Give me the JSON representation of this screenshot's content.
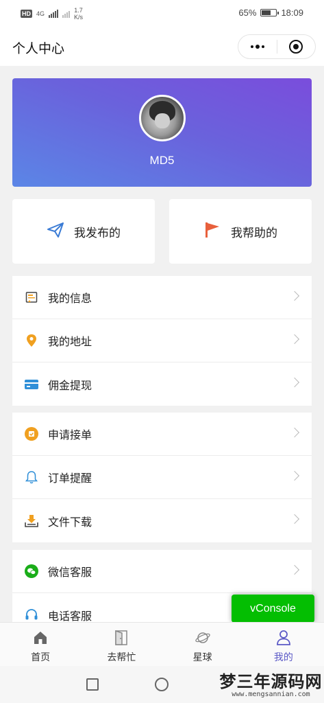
{
  "status_bar": {
    "hd": "HD",
    "network": "4G",
    "speed_value": "1.7",
    "speed_unit": "K/s",
    "battery": "65%",
    "battery_level": 0.65,
    "time": "18:09"
  },
  "navbar": {
    "title": "个人中心",
    "more_icon": "more-dots-icon",
    "close_icon": "target-icon"
  },
  "profile": {
    "username": "MD5",
    "avatar": "avatar-photo",
    "gradient_start": "#7a4ddc",
    "gradient_end": "#5b86e6"
  },
  "quick_cards": [
    {
      "label": "我发布的",
      "icon": "paper-plane-icon",
      "color": "#3a7bd5"
    },
    {
      "label": "我帮助的",
      "icon": "flag-icon",
      "color": "#e8603c"
    }
  ],
  "menu_groups": [
    [
      {
        "label": "我的信息",
        "icon": "info-card-icon",
        "color": "#f0a020"
      },
      {
        "label": "我的地址",
        "icon": "location-pin-icon",
        "color": "#f0a020"
      },
      {
        "label": "佣金提现",
        "icon": "credit-card-icon",
        "color": "#2f8fd8"
      }
    ],
    [
      {
        "label": "申请接单",
        "icon": "apply-badge-icon",
        "color": "#f0a020"
      },
      {
        "label": "订单提醒",
        "icon": "bell-icon",
        "color": "#2f8fd8"
      },
      {
        "label": "文件下载",
        "icon": "download-tray-icon",
        "color": "#f0a020"
      }
    ],
    [
      {
        "label": "微信客服",
        "icon": "wechat-icon",
        "color": "#1aad19"
      },
      {
        "label": "电话客服",
        "icon": "headset-icon",
        "color": "#2f8fd8"
      }
    ]
  ],
  "vconsole": {
    "label": "vConsole",
    "color": "#04be02"
  },
  "tabbar": {
    "active_color": "#5b59c6",
    "items": [
      {
        "label": "首页",
        "icon": "home-icon"
      },
      {
        "label": "去帮忙",
        "icon": "door-icon"
      },
      {
        "label": "星球",
        "icon": "planet-icon"
      },
      {
        "label": "我的",
        "icon": "user-icon",
        "active": true
      }
    ]
  },
  "system_nav": {
    "recents_icon": "square-icon",
    "home_icon": "circle-icon"
  },
  "watermark": {
    "main": "梦三年源码网",
    "sub": "www.mengsannian.com"
  }
}
